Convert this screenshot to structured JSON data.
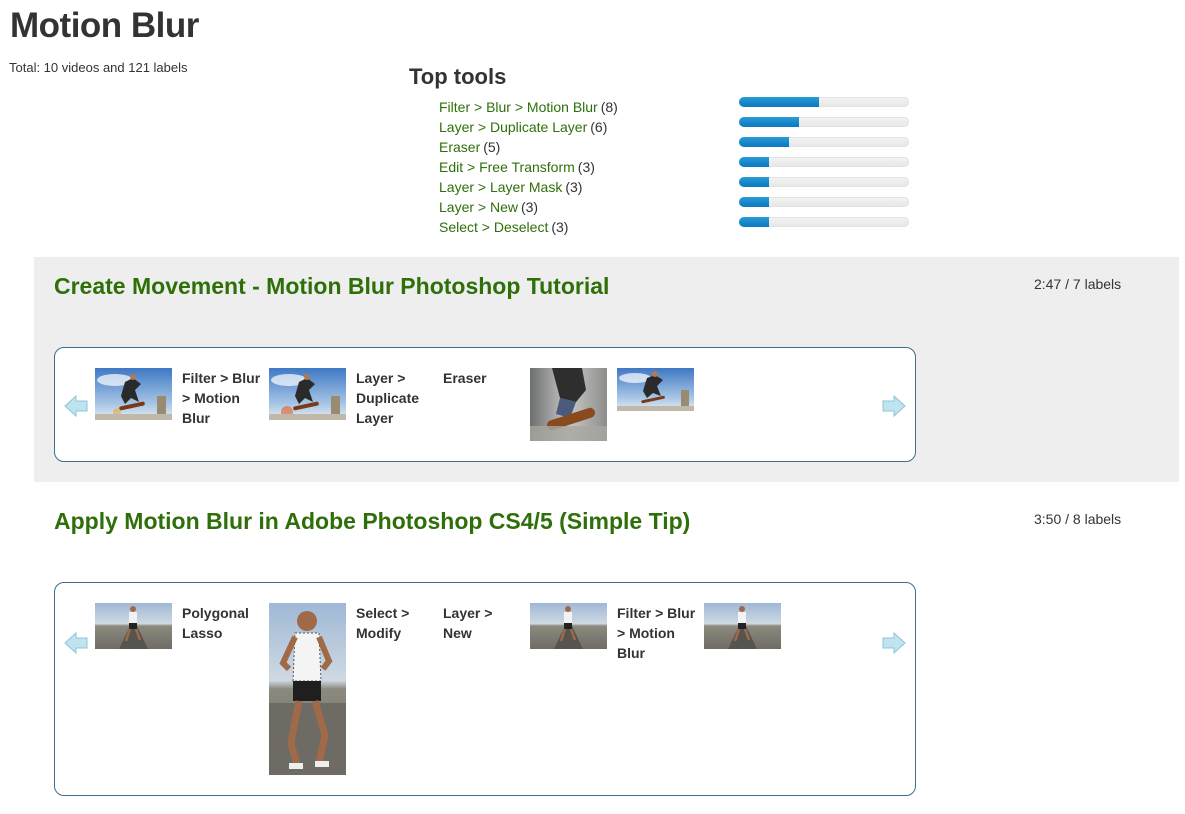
{
  "page": {
    "title": "Motion Blur",
    "total": "Total: 10 videos and 121 labels"
  },
  "top_tools": {
    "title": "Top tools",
    "items": [
      {
        "label": "Filter > Blur > Motion Blur",
        "count": "(8)",
        "value": 8
      },
      {
        "label": "Layer > Duplicate Layer",
        "count": "(6)",
        "value": 6
      },
      {
        "label": "Eraser",
        "count": "(5)",
        "value": 5
      },
      {
        "label": "Edit > Free Transform",
        "count": "(3)",
        "value": 3
      },
      {
        "label": "Layer > Layer Mask",
        "count": "(3)",
        "value": 3
      },
      {
        "label": "Layer > New",
        "count": "(3)",
        "value": 3
      },
      {
        "label": "Select > Deselect",
        "count": "(3)",
        "value": 3
      }
    ],
    "max_value": 17
  },
  "videos": [
    {
      "title": "Create Movement - Motion Blur Photoshop Tutorial",
      "meta": "2:47 / 7 labels",
      "items": [
        {
          "kind": "thumb",
          "image": "skateboarder-jump"
        },
        {
          "kind": "label",
          "text": "Filter > Blur > Motion Blur"
        },
        {
          "kind": "thumb",
          "image": "skateboarder-jump"
        },
        {
          "kind": "label",
          "text": "Layer > Duplicate Layer"
        },
        {
          "kind": "label",
          "text": "Eraser"
        },
        {
          "kind": "thumb",
          "image": "skateboarder-blur-closeup"
        },
        {
          "kind": "thumb",
          "image": "skateboarder-jump"
        }
      ]
    },
    {
      "title": "Apply Motion Blur in Adobe Photoshop CS4/5 (Simple Tip)",
      "meta": "3:50 / 8 labels",
      "items": [
        {
          "kind": "thumb",
          "image": "runner-road"
        },
        {
          "kind": "label",
          "text": "Polygonal Lasso"
        },
        {
          "kind": "thumb",
          "image": "runner-selection"
        },
        {
          "kind": "label",
          "text": "Select > Modify"
        },
        {
          "kind": "label",
          "text": "Layer > New"
        },
        {
          "kind": "thumb",
          "image": "runner-road"
        },
        {
          "kind": "label",
          "text": "Filter > Blur > Motion Blur"
        },
        {
          "kind": "thumb",
          "image": "runner-road"
        }
      ]
    }
  ],
  "colors": {
    "link_green": "#2f6f0a",
    "bar_blue": "#0a78bf",
    "carousel_border": "#3a6f8f",
    "shaded_bg": "#eeeeee"
  },
  "icons": {
    "prev": "left-arrow-icon",
    "next": "right-arrow-icon"
  }
}
